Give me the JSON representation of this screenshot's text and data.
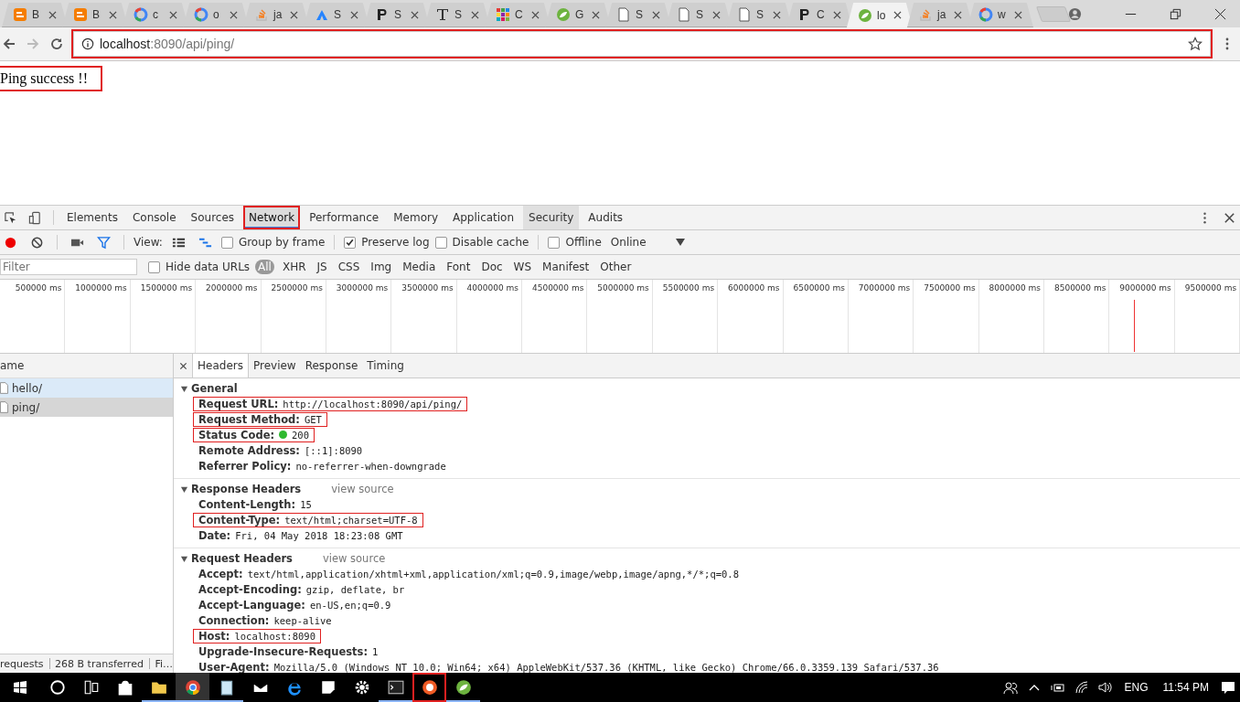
{
  "browser_tabs": [
    {
      "title": "B",
      "kind": "blogger",
      "selected": false
    },
    {
      "title": "B",
      "kind": "blogger",
      "selected": false
    },
    {
      "title": "c",
      "kind": "google",
      "selected": false
    },
    {
      "title": "o",
      "kind": "google",
      "selected": false
    },
    {
      "title": "ja",
      "kind": "stack",
      "selected": false
    },
    {
      "title": "S",
      "kind": "peak",
      "selected": false
    },
    {
      "title": "S",
      "kind": "letter-p",
      "selected": false
    },
    {
      "title": "S",
      "kind": "letter-t",
      "selected": false
    },
    {
      "title": "C",
      "kind": "grid",
      "selected": false
    },
    {
      "title": "G",
      "kind": "leaf",
      "selected": false
    },
    {
      "title": "S",
      "kind": "doc",
      "selected": false
    },
    {
      "title": "S",
      "kind": "doc",
      "selected": false
    },
    {
      "title": "S",
      "kind": "doc",
      "selected": false
    },
    {
      "title": "C",
      "kind": "letter-p",
      "selected": false
    },
    {
      "title": "lo",
      "kind": "leaf",
      "selected": true
    },
    {
      "title": "ja",
      "kind": "stack",
      "selected": false
    },
    {
      "title": "w",
      "kind": "google",
      "selected": false
    }
  ],
  "address_bar": {
    "host": "localhost",
    "path": ":8090/api/ping/",
    "highlighted": true
  },
  "page": {
    "text": "Ping success !!",
    "highlighted": true
  },
  "devtools": {
    "tabs": [
      {
        "label": "Elements",
        "selected": false,
        "hovered": false,
        "highlighted": false
      },
      {
        "label": "Console",
        "selected": false,
        "hovered": false,
        "highlighted": false
      },
      {
        "label": "Sources",
        "selected": false,
        "hovered": false,
        "highlighted": false
      },
      {
        "label": "Network",
        "selected": true,
        "hovered": false,
        "highlighted": true
      },
      {
        "label": "Performance",
        "selected": false,
        "hovered": false,
        "highlighted": false
      },
      {
        "label": "Memory",
        "selected": false,
        "hovered": false,
        "highlighted": false
      },
      {
        "label": "Application",
        "selected": false,
        "hovered": false,
        "highlighted": false
      },
      {
        "label": "Security",
        "selected": false,
        "hovered": true,
        "highlighted": false
      },
      {
        "label": "Audits",
        "selected": false,
        "hovered": false,
        "highlighted": false
      }
    ],
    "toolbar": {
      "recording": true,
      "view_label": "View:",
      "checkboxes": [
        {
          "label": "Group by frame",
          "checked": false
        },
        {
          "label": "Preserve log",
          "checked": true
        },
        {
          "label": "Disable cache",
          "checked": false
        },
        {
          "label": "Offline",
          "checked": false
        }
      ],
      "throttle": "Online"
    },
    "filter": {
      "placeholder": "Filter",
      "hide_data_urls": {
        "label": "Hide data URLs",
        "checked": false
      },
      "types": [
        {
          "label": "All",
          "selected": true
        },
        {
          "label": "XHR",
          "selected": false
        },
        {
          "label": "JS",
          "selected": false
        },
        {
          "label": "CSS",
          "selected": false
        },
        {
          "label": "Img",
          "selected": false
        },
        {
          "label": "Media",
          "selected": false
        },
        {
          "label": "Font",
          "selected": false
        },
        {
          "label": "Doc",
          "selected": false
        },
        {
          "label": "WS",
          "selected": false
        },
        {
          "label": "Manifest",
          "selected": false
        },
        {
          "label": "Other",
          "selected": false
        }
      ]
    },
    "timeline_ticks": [
      "500000 ms",
      "1000000 ms",
      "1500000 ms",
      "2000000 ms",
      "2500000 ms",
      "3000000 ms",
      "3500000 ms",
      "4000000 ms",
      "4500000 ms",
      "5000000 ms",
      "5500000 ms",
      "6000000 ms",
      "6500000 ms",
      "7000000 ms",
      "7500000 ms",
      "8000000 ms",
      "8500000 ms",
      "9000000 ms",
      "9500000 ms"
    ],
    "requests": {
      "column": "ame",
      "rows": [
        {
          "name": "hello/",
          "selected": false,
          "hovered": true
        },
        {
          "name": "ping/",
          "selected": true,
          "hovered": false
        }
      ]
    },
    "detail_tabs": [
      {
        "label": "Headers",
        "selected": true
      },
      {
        "label": "Preview",
        "selected": false
      },
      {
        "label": "Response",
        "selected": false
      },
      {
        "label": "Timing",
        "selected": false
      }
    ],
    "sections": [
      {
        "title": "General",
        "expanded": true,
        "rows": [
          {
            "name": "Request URL:",
            "value": "http://localhost:8090/api/ping/",
            "highlighted": true
          },
          {
            "name": "Request Method:",
            "value": "GET",
            "highlighted": true
          },
          {
            "name": "Status Code:",
            "value": "200",
            "highlighted": true,
            "color": "#2fb82f"
          },
          {
            "name": "Remote Address:",
            "value": "[::1]:8090",
            "highlighted": false
          },
          {
            "name": "Referrer Policy:",
            "value": "no-referrer-when-downgrade",
            "highlighted": false
          }
        ]
      },
      {
        "title": "Response Headers",
        "expanded": true,
        "link": "view source",
        "rows": [
          {
            "name": "Content-Length:",
            "value": "15",
            "highlighted": false
          },
          {
            "name": "Content-Type:",
            "value": "text/html;charset=UTF-8",
            "highlighted": true
          },
          {
            "name": "Date:",
            "value": "Fri, 04 May 2018 18:23:08 GMT",
            "highlighted": false
          }
        ]
      },
      {
        "title": "Request Headers",
        "expanded": true,
        "link": "view source",
        "rows": [
          {
            "name": "Accept:",
            "value": "text/html,application/xhtml+xml,application/xml;q=0.9,image/webp,image/apng,*/*;q=0.8",
            "highlighted": false
          },
          {
            "name": "Accept-Encoding:",
            "value": "gzip, deflate, br",
            "highlighted": false
          },
          {
            "name": "Accept-Language:",
            "value": "en-US,en;q=0.9",
            "highlighted": false
          },
          {
            "name": "Connection:",
            "value": "keep-alive",
            "highlighted": false
          },
          {
            "name": "Host:",
            "value": "localhost:8090",
            "highlighted": true
          },
          {
            "name": "Upgrade-Insecure-Requests:",
            "value": "1",
            "highlighted": false
          },
          {
            "name": "User-Agent:",
            "value": "Mozilla/5.0 (Windows NT 10.0; Win64; x64) AppleWebKit/537.36 (KHTML, like Gecko) Chrome/66.0.3359.139 Safari/537.36",
            "highlighted": false
          }
        ]
      }
    ],
    "status": [
      "requests",
      "268 B transferred",
      "Fi…"
    ]
  },
  "taskbar": {
    "apps": [
      {
        "kind": "search",
        "running": false,
        "active": false,
        "highlighted": false
      },
      {
        "kind": "taskview",
        "running": false,
        "active": false,
        "highlighted": false
      },
      {
        "kind": "store",
        "running": false,
        "active": false,
        "highlighted": false
      },
      {
        "kind": "folder",
        "running": true,
        "active": false,
        "highlighted": false
      },
      {
        "kind": "chrome",
        "running": true,
        "active": true,
        "highlighted": false
      },
      {
        "kind": "notepad",
        "running": true,
        "active": false,
        "highlighted": false
      },
      {
        "kind": "mail",
        "running": false,
        "active": false,
        "highlighted": false
      },
      {
        "kind": "edge",
        "running": false,
        "active": false,
        "highlighted": false
      },
      {
        "kind": "note",
        "running": false,
        "active": false,
        "highlighted": false
      },
      {
        "kind": "gear",
        "running": false,
        "active": false,
        "highlighted": false
      },
      {
        "kind": "console",
        "running": true,
        "active": false,
        "highlighted": false
      },
      {
        "kind": "rocket",
        "running": true,
        "active": false,
        "highlighted": true
      },
      {
        "kind": "leaf",
        "running": true,
        "active": false,
        "highlighted": false
      }
    ],
    "language": "ENG",
    "time": "11:54 PM"
  }
}
